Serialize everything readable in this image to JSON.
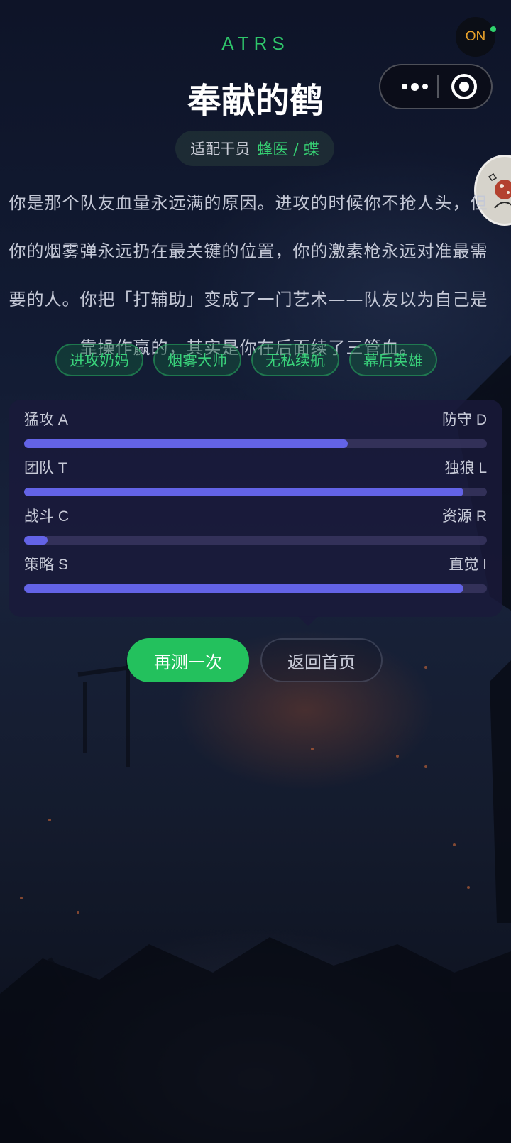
{
  "topbar": {
    "status_label": "ON",
    "status_dot_color": "#2fd26e",
    "more_icon": "more-dots-icon",
    "close_icon": "target-circle-icon"
  },
  "header": {
    "brand": "ATRS",
    "title": "奉献的鹤",
    "fit_label": "适配干员",
    "fit_value": "蜂医 / 蝶"
  },
  "description": "你是那个队友血量永远满的原因。进攻的时候你不抢人头，但你的烟雾弹永远扔在最关键的位置，你的激素枪永远对准最需要的人。你把「打辅助」变成了一门艺术——队友以为自己是靠操作赢的，其实是你在后面续了三管血。",
  "tags": [
    "进攻奶妈",
    "烟雾大师",
    "无私续航",
    "幕后英雄"
  ],
  "dimensions": [
    {
      "left": "猛攻 A",
      "right": "防守 D",
      "ratio": 0.7
    },
    {
      "left": "团队 T",
      "right": "独狼 L",
      "ratio": 0.95
    },
    {
      "left": "战斗 C",
      "right": "资源 R",
      "ratio": 0.05
    },
    {
      "left": "策略 S",
      "right": "直觉 I",
      "ratio": 0.95
    }
  ],
  "actions": {
    "retry": "再测一次",
    "home": "返回首页"
  },
  "colors": {
    "accent_green": "#2fc66b",
    "bar_fill": "#6363e6",
    "status_text": "#e9a22b"
  }
}
